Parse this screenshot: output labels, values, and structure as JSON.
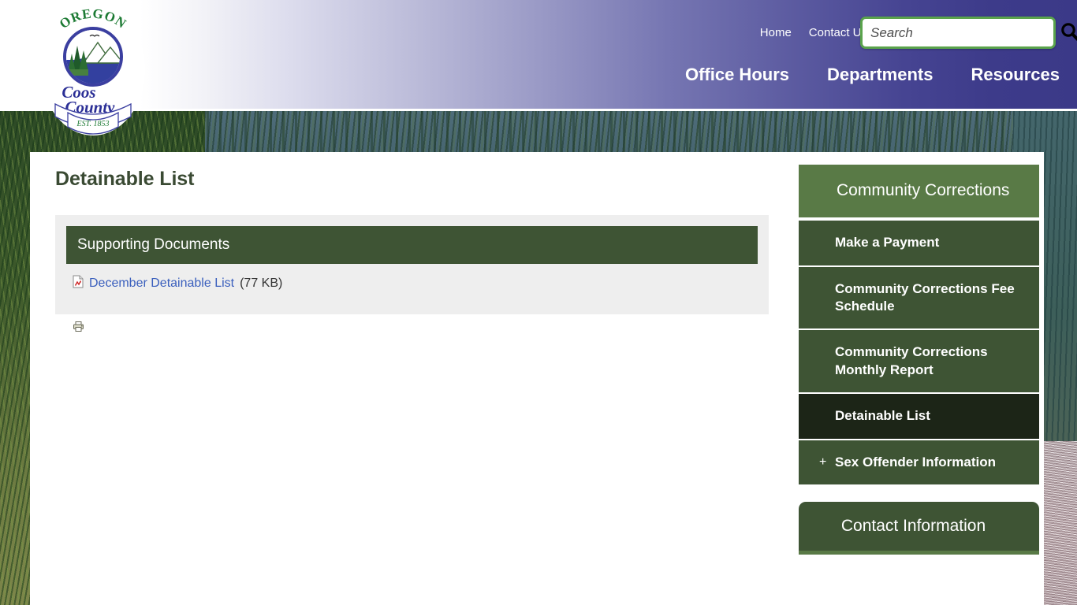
{
  "header": {
    "logo_alt": "Oregon Coos County Est. 1853 seal",
    "logo_text": {
      "top": "OREGON",
      "line1": "Coos",
      "line2": "County",
      "banner": "EST. 1853"
    },
    "utility_nav": [
      {
        "label": "Home",
        "name": "nav-home"
      },
      {
        "label": "Contact Us",
        "name": "nav-contact-us"
      }
    ],
    "search": {
      "placeholder": "Search",
      "value": "",
      "button_title": "Search",
      "icon": "search-icon"
    },
    "main_nav": [
      {
        "label": "Office Hours",
        "name": "nav-office-hours"
      },
      {
        "label": "Departments",
        "name": "nav-departments"
      },
      {
        "label": "Resources",
        "name": "nav-resources"
      }
    ]
  },
  "main": {
    "page_title": "Detainable List",
    "supporting_documents": {
      "header": "Supporting Documents",
      "items": [
        {
          "icon": "pdf-file-icon",
          "link_label": "December Detainable List",
          "size": "(77 KB)"
        }
      ]
    },
    "print_button": {
      "icon": "printer-icon",
      "title": "Print"
    }
  },
  "sidebar": {
    "section_title": "Community Corrections",
    "menu": [
      {
        "label": "Make a Payment",
        "active": false,
        "expandable": false,
        "expander": ""
      },
      {
        "label": "Community Corrections Fee Schedule",
        "active": false,
        "expandable": false,
        "expander": ""
      },
      {
        "label": "Community Corrections Monthly Report",
        "active": false,
        "expandable": false,
        "expander": ""
      },
      {
        "label": "Detainable List",
        "active": true,
        "expandable": false,
        "expander": ""
      },
      {
        "label": "Sex Offender Information",
        "active": false,
        "expandable": true,
        "expander": "+"
      }
    ],
    "contact_panel_title": "Contact Information"
  },
  "colors": {
    "header_purple": "#3b3988",
    "search_border_green": "#5aa34c",
    "section_green_light": "#597a46",
    "section_green_dark": "#3e5434",
    "menu_active": "#1c2517",
    "link_blue": "#3a5fbd",
    "panel_gray": "#eeeeee",
    "title_text": "#3a4a33"
  }
}
